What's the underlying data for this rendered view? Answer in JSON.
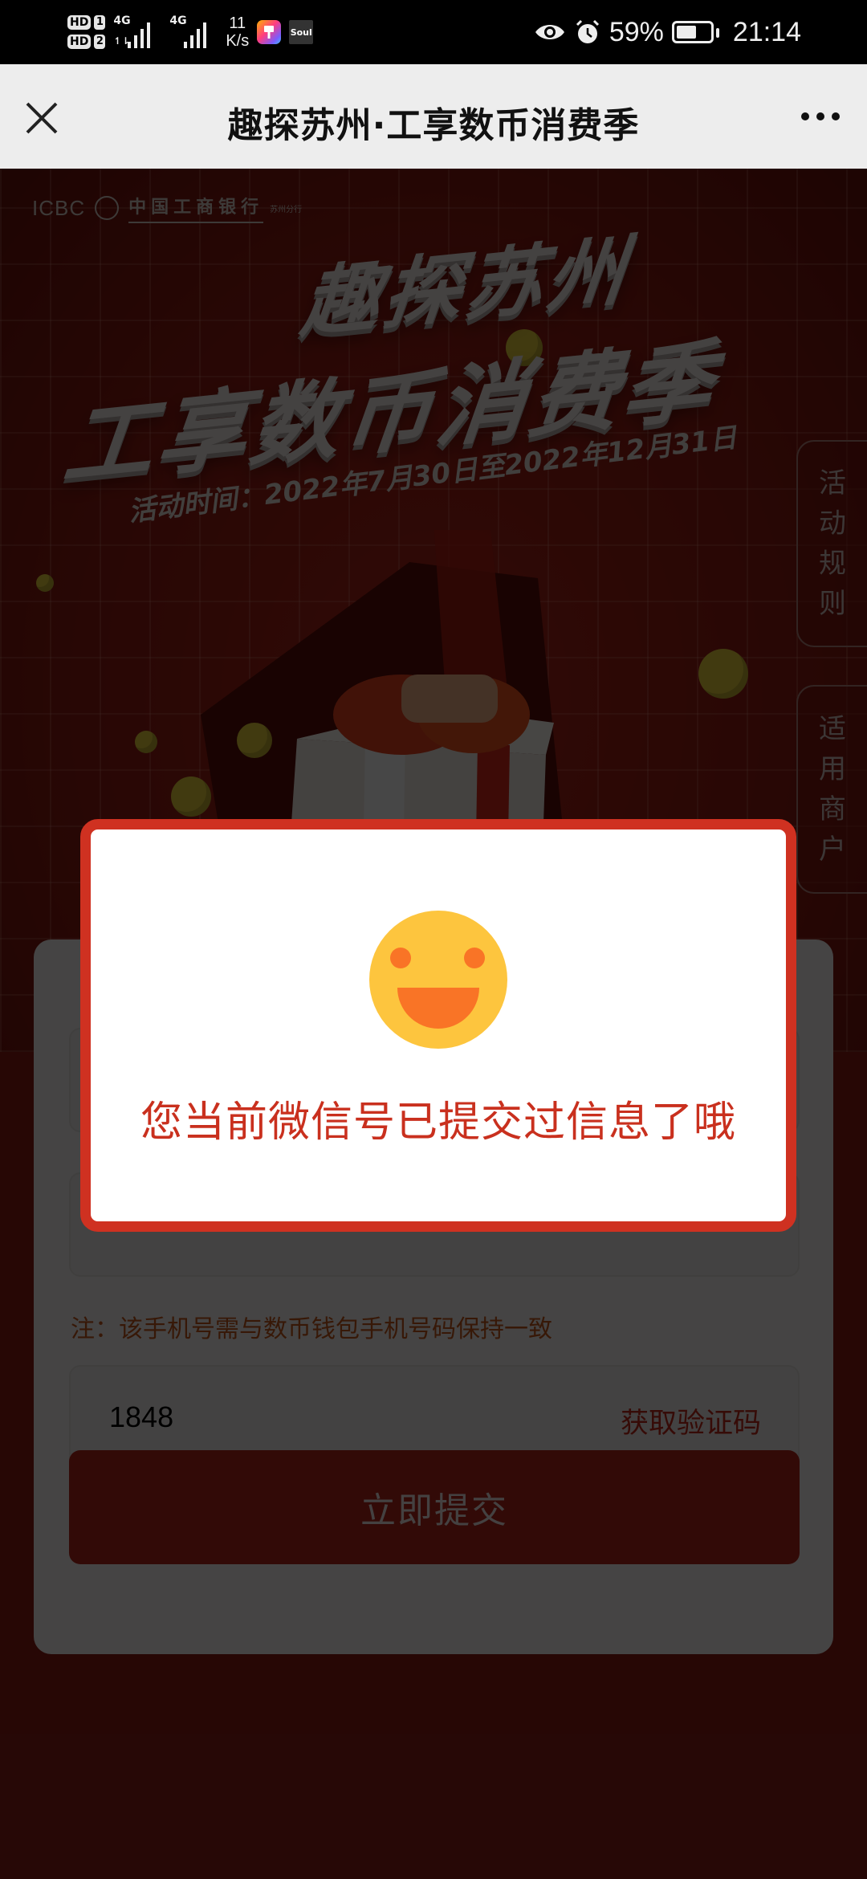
{
  "status_bar": {
    "sim1_label": "HD",
    "sim1_num": "1",
    "sim2_label": "HD",
    "sim2_num": "2",
    "network1": "4G",
    "network2": "4G",
    "net_speed_value": "11",
    "net_speed_unit": "K/s",
    "app_icons": [
      "paint-brush-app-icon",
      "soul-app-icon"
    ],
    "soul_label": "Soul",
    "battery_percent": "59%",
    "battery_level": 0.59,
    "time": "21:14"
  },
  "title_bar": {
    "title": "趣探苏州·工享数币消费季",
    "close_icon": "close-icon",
    "more_icon": "more-horizontal-icon"
  },
  "hero": {
    "bank_logo_en": "ICBC",
    "bank_name": "中国工商银行",
    "branch": "苏州分行",
    "title_line1": "趣探苏州",
    "title_line2": "工享数币消费季",
    "activity_date": "活动时间：2022年7月30日至2022年12月31日"
  },
  "side_tabs": [
    {
      "label": [
        "活",
        "动",
        "规",
        "则"
      ]
    },
    {
      "label": [
        "适",
        "用",
        "商",
        "户"
      ]
    }
  ],
  "form": {
    "note": "注：该手机号需与数币钱包手机号码保持一致",
    "code_field_value": "1848",
    "get_code_label": "获取验证码",
    "submit_label": "立即提交"
  },
  "dialog": {
    "icon": "smiley-face-icon",
    "message": "您当前微信号已提交过信息了哦"
  },
  "colors": {
    "accent_red": "#cf3121",
    "message_red": "#c9301e",
    "smiley_yellow": "#fdc53e",
    "smiley_orange": "#f97426",
    "note_orange": "#c6571c"
  }
}
